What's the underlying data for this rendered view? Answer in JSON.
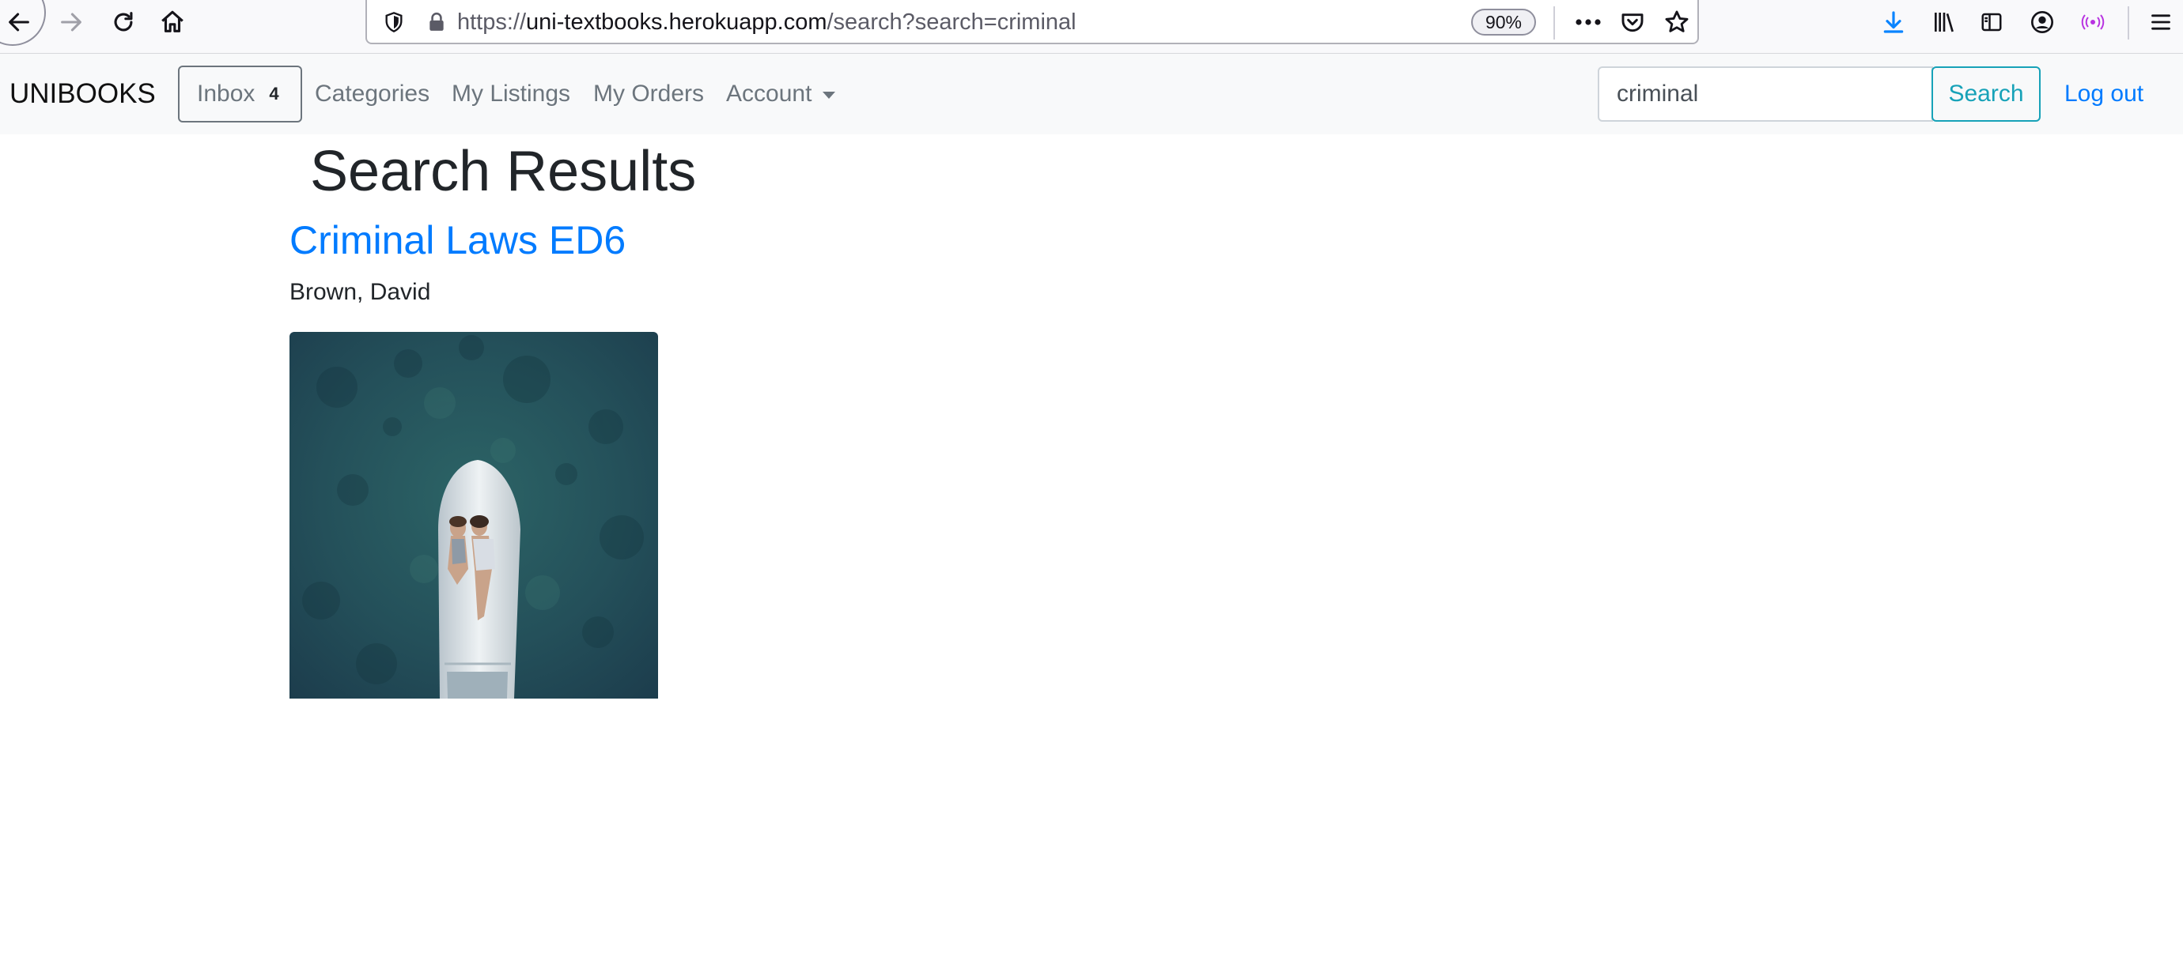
{
  "browser": {
    "url_prefix": "https://",
    "url_host": "uni-textbooks.herokuapp.com",
    "url_path": "/search?search=criminal",
    "zoom": "90%",
    "icons": [
      "back-icon",
      "forward-icon",
      "reload-icon",
      "home-icon",
      "shield-icon",
      "lock-icon",
      "more-icon",
      "pocket-icon",
      "star-icon",
      "download-icon",
      "library-icon",
      "sidebar-icon",
      "account-icon",
      "extension-icon",
      "menu-icon"
    ]
  },
  "navbar": {
    "brand": "UNIBOOKS",
    "inbox_label": "Inbox",
    "inbox_count": "4",
    "links": {
      "categories": "Categories",
      "my_listings": "My Listings",
      "my_orders": "My Orders",
      "account": "Account"
    },
    "search_value": "criminal",
    "search_button": "Search",
    "logout": "Log out",
    "colors": {
      "primary": "#007bff",
      "info": "#17a2b8",
      "secondary": "#6c757d"
    }
  },
  "main": {
    "title": "Search Results",
    "results": [
      {
        "title": "Criminal Laws ED6",
        "author": "Brown, David"
      }
    ]
  }
}
